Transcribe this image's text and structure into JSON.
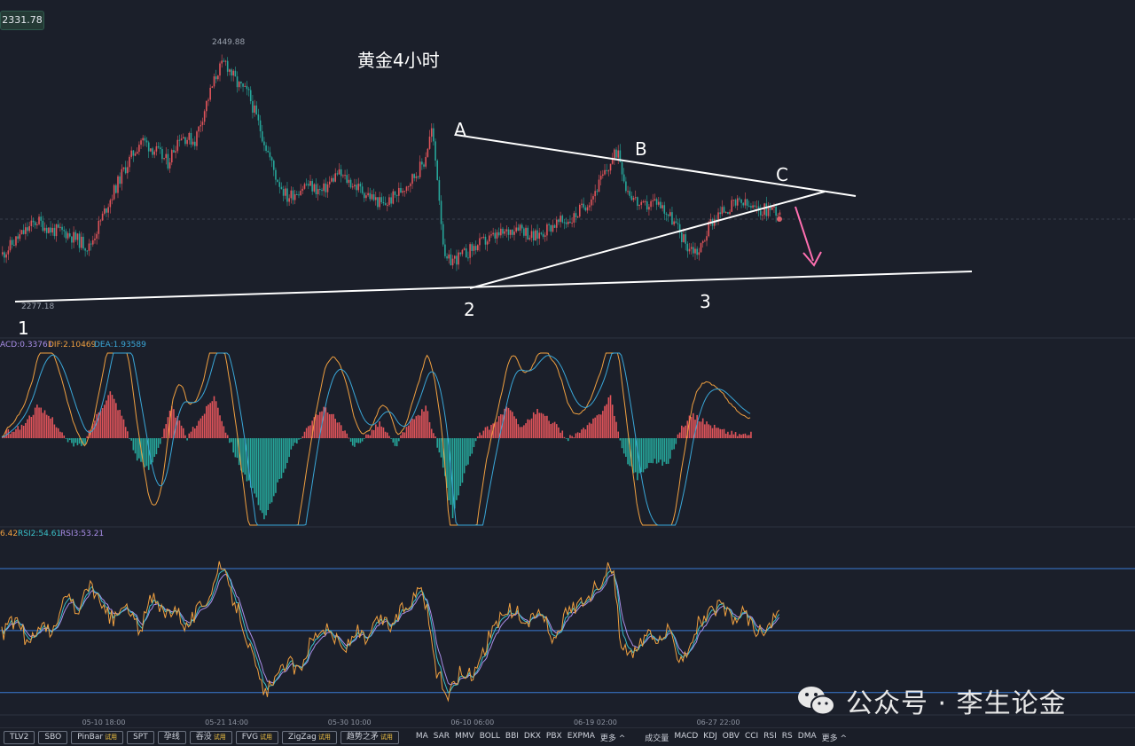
{
  "price_badge": "2331.78",
  "chart_title": "黄金4小时",
  "labels": {
    "high": "2449.88",
    "low": "2277.18",
    "wave_points": [
      "A",
      "B",
      "C",
      "1",
      "2",
      "3"
    ]
  },
  "macd_header": {
    "macd": "ACD:0.33761",
    "dif": "DIF:2.10469",
    "dea": "DEA:1.93589"
  },
  "rsi_header": {
    "rsi1": "6.42",
    "rsi2": "RSI2:54.61",
    "rsi3": "RSI3:53.21"
  },
  "time_axis": [
    "05-10 18:00",
    "05-21 14:00",
    "05-30 10:00",
    "06-10 06:00",
    "06-19 02:00",
    "06-27 22:00"
  ],
  "toolbar": {
    "tools": [
      {
        "label": "TLV2",
        "badge": ""
      },
      {
        "label": "SBO",
        "badge": ""
      },
      {
        "label": "PinBar",
        "badge": "试用"
      },
      {
        "label": "SPT",
        "badge": ""
      },
      {
        "label": "孕线",
        "badge": ""
      },
      {
        "label": "吞没",
        "badge": "试用"
      },
      {
        "label": "FVG",
        "badge": "试用"
      },
      {
        "label": "ZigZag",
        "badge": "试用"
      },
      {
        "label": "趋势之矛",
        "badge": "试用"
      }
    ],
    "main_indicators": [
      "MA",
      "SAR",
      "MMV",
      "BOLL",
      "BBI",
      "DKX",
      "PBX",
      "EXPMA",
      "更多 ^"
    ],
    "sub_indicators": [
      "成交量",
      "MACD",
      "KDJ",
      "OBV",
      "CCI",
      "RSI",
      "RS",
      "DMA",
      "更多 ^"
    ]
  },
  "watermark": "公众号 · 李生论金",
  "colors": {
    "background": "#1b1f2a",
    "bull": "#e0545a",
    "bear": "#26a69a",
    "dif_line": "#f0a040",
    "dea_line": "#3aa7d8",
    "rsi1": "#f0a040",
    "rsi2": "#3ac0c8",
    "rsi3": "#a98ee8",
    "trendline": "#ffffff",
    "arrow": "#ff6fb0",
    "rsi_levels": "#3a7bd5"
  },
  "chart_data": {
    "type": "candlestick",
    "title": "黄金4小时",
    "ylim": [
      2263,
      2462
    ],
    "price_high": 2449.88,
    "price_low": 2277.18,
    "current_price": 2331.78,
    "close_path": [
      [
        0,
        2300
      ],
      [
        8,
        2312
      ],
      [
        18,
        2325
      ],
      [
        25,
        2318
      ],
      [
        33,
        2316
      ],
      [
        45,
        2305
      ],
      [
        55,
        2338
      ],
      [
        63,
        2362
      ],
      [
        72,
        2385
      ],
      [
        80,
        2376
      ],
      [
        86,
        2368
      ],
      [
        92,
        2388
      ],
      [
        100,
        2384
      ],
      [
        106,
        2412
      ],
      [
        112,
        2436
      ],
      [
        116,
        2442
      ],
      [
        122,
        2426
      ],
      [
        128,
        2418
      ],
      [
        136,
        2384
      ],
      [
        142,
        2358
      ],
      [
        148,
        2342
      ],
      [
        158,
        2352
      ],
      [
        166,
        2346
      ],
      [
        174,
        2360
      ],
      [
        182,
        2352
      ],
      [
        190,
        2344
      ],
      [
        198,
        2336
      ],
      [
        206,
        2346
      ],
      [
        214,
        2358
      ],
      [
        219,
        2368
      ],
      [
        223,
        2392
      ],
      [
        226,
        2358
      ],
      [
        230,
        2294
      ],
      [
        238,
        2298
      ],
      [
        246,
        2306
      ],
      [
        254,
        2312
      ],
      [
        262,
        2316
      ],
      [
        268,
        2322
      ],
      [
        276,
        2312
      ],
      [
        286,
        2322
      ],
      [
        296,
        2326
      ],
      [
        306,
        2342
      ],
      [
        314,
        2362
      ],
      [
        320,
        2378
      ],
      [
        324,
        2350
      ],
      [
        332,
        2334
      ],
      [
        340,
        2340
      ],
      [
        348,
        2326
      ],
      [
        356,
        2306
      ],
      [
        362,
        2302
      ],
      [
        368,
        2324
      ],
      [
        376,
        2334
      ],
      [
        384,
        2338
      ],
      [
        392,
        2332
      ],
      [
        400,
        2334
      ],
      [
        404,
        2331.78
      ]
    ],
    "wave_points": [
      {
        "label": "1",
        "price": 2277.18
      },
      {
        "label": "A",
        "price": 2390
      },
      {
        "label": "2",
        "price": 2286
      },
      {
        "label": "B",
        "price": 2376
      },
      {
        "label": "3",
        "price": 2305
      },
      {
        "label": "C",
        "price": 2352
      }
    ],
    "macd": {
      "macd": 0.33761,
      "dif": 2.10469,
      "dea": 1.93589,
      "ylim": [
        -20,
        22
      ],
      "hist_path": [
        [
          0,
          1
        ],
        [
          10,
          3
        ],
        [
          18,
          8
        ],
        [
          26,
          5
        ],
        [
          34,
          -1
        ],
        [
          42,
          -2
        ],
        [
          48,
          5
        ],
        [
          56,
          12
        ],
        [
          62,
          6
        ],
        [
          70,
          -5
        ],
        [
          76,
          -7
        ],
        [
          82,
          -1
        ],
        [
          88,
          8
        ],
        [
          96,
          0
        ],
        [
          104,
          6
        ],
        [
          110,
          11
        ],
        [
          116,
          2
        ],
        [
          122,
          -5
        ],
        [
          130,
          -12
        ],
        [
          136,
          -19
        ],
        [
          142,
          -12
        ],
        [
          150,
          -3
        ],
        [
          160,
          4
        ],
        [
          168,
          8
        ],
        [
          176,
          3
        ],
        [
          182,
          -2
        ],
        [
          190,
          1
        ],
        [
          196,
          4
        ],
        [
          204,
          -2
        ],
        [
          212,
          4
        ],
        [
          220,
          8
        ],
        [
          228,
          -5
        ],
        [
          234,
          -18
        ],
        [
          240,
          -8
        ],
        [
          248,
          1
        ],
        [
          256,
          4
        ],
        [
          262,
          8
        ],
        [
          270,
          3
        ],
        [
          278,
          7
        ],
        [
          286,
          4
        ],
        [
          294,
          0
        ],
        [
          302,
          2
        ],
        [
          310,
          6
        ],
        [
          316,
          11
        ],
        [
          322,
          -3
        ],
        [
          330,
          -9
        ],
        [
          338,
          -5
        ],
        [
          346,
          -6
        ],
        [
          352,
          2
        ],
        [
          358,
          6
        ],
        [
          366,
          4
        ],
        [
          374,
          2
        ],
        [
          382,
          1
        ],
        [
          390,
          1
        ]
      ]
    },
    "rsi": {
      "rsi1": 56.42,
      "rsi2": 54.61,
      "rsi3": 53.21,
      "ylim": [
        10,
        95
      ],
      "levels": [
        80,
        50,
        20
      ],
      "rsi1_path": [
        [
          0,
          48
        ],
        [
          8,
          56
        ],
        [
          14,
          42
        ],
        [
          20,
          54
        ],
        [
          26,
          47
        ],
        [
          34,
          68
        ],
        [
          40,
          58
        ],
        [
          46,
          74
        ],
        [
          52,
          60
        ],
        [
          58,
          55
        ],
        [
          64,
          62
        ],
        [
          72,
          50
        ],
        [
          78,
          66
        ],
        [
          84,
          58
        ],
        [
          90,
          62
        ],
        [
          96,
          52
        ],
        [
          102,
          60
        ],
        [
          108,
          68
        ],
        [
          114,
          82
        ],
        [
          118,
          70
        ],
        [
          124,
          58
        ],
        [
          130,
          38
        ],
        [
          136,
          20
        ],
        [
          142,
          24
        ],
        [
          148,
          36
        ],
        [
          154,
          30
        ],
        [
          160,
          44
        ],
        [
          166,
          52
        ],
        [
          172,
          48
        ],
        [
          178,
          40
        ],
        [
          184,
          50
        ],
        [
          190,
          44
        ],
        [
          196,
          56
        ],
        [
          202,
          52
        ],
        [
          208,
          60
        ],
        [
          214,
          66
        ],
        [
          218,
          74
        ],
        [
          222,
          54
        ],
        [
          226,
          30
        ],
        [
          232,
          18
        ],
        [
          238,
          30
        ],
        [
          244,
          28
        ],
        [
          250,
          40
        ],
        [
          256,
          52
        ],
        [
          262,
          60
        ],
        [
          268,
          58
        ],
        [
          274,
          54
        ],
        [
          280,
          60
        ],
        [
          286,
          46
        ],
        [
          292,
          56
        ],
        [
          298,
          62
        ],
        [
          304,
          66
        ],
        [
          310,
          72
        ],
        [
          314,
          80
        ],
        [
          318,
          76
        ],
        [
          322,
          42
        ],
        [
          328,
          36
        ],
        [
          334,
          48
        ],
        [
          340,
          44
        ],
        [
          346,
          50
        ],
        [
          352,
          38
        ],
        [
          356,
          40
        ],
        [
          362,
          54
        ],
        [
          368,
          58
        ],
        [
          374,
          62
        ],
        [
          380,
          54
        ],
        [
          386,
          60
        ],
        [
          390,
          52
        ],
        [
          396,
          48
        ],
        [
          404,
          58
        ]
      ]
    }
  }
}
